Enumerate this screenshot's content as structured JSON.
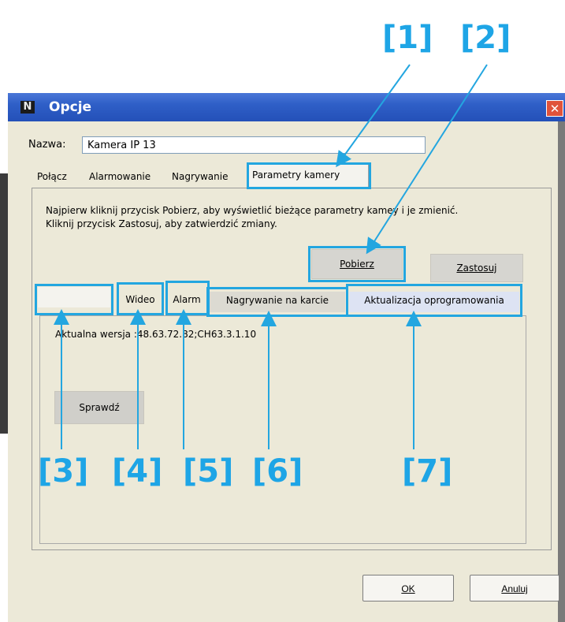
{
  "window": {
    "title": "Opcje",
    "app_icon_glyph": "N",
    "close_glyph": "✕"
  },
  "name_field": {
    "label": "Nazwa:",
    "value": "Kamera IP 13"
  },
  "tabs": [
    {
      "label": "Połącz",
      "active": false
    },
    {
      "label": "Alarmowanie",
      "active": false
    },
    {
      "label": "Nagrywanie",
      "active": false
    },
    {
      "label": "Parametry kamery",
      "active": true
    }
  ],
  "info_text": {
    "line1": "Najpierw kliknij przycisk Pobierz, aby wyświetlić bieżące parametry kamey i  je zmienić.",
    "line2": "Kliknij przycisk Zastosuj, aby zatwierdzić zmiany."
  },
  "buttons": {
    "fetch": "Pobierz",
    "apply": "Zastosuj",
    "check": "Sprawdź",
    "ok": "OK",
    "cancel": "Anuluj"
  },
  "subtabs": [
    {
      "label": "",
      "active": false
    },
    {
      "label": "Wideo",
      "active": false
    },
    {
      "label": "Alarm",
      "active": false
    },
    {
      "label": "Nagrywanie na karcie",
      "active": false
    },
    {
      "label": "Aktualizacja oprogramowania",
      "active": true
    }
  ],
  "version": {
    "text": "Aktualna wersja :48.63.72.82;CH63.3.1.10"
  },
  "markers": [
    "[1]",
    "[2]",
    "[3]",
    "[4]",
    "[5]",
    "[6]",
    "[7]"
  ],
  "colors": {
    "annotation": "#23a6e0",
    "titlebar": "#2f5fc7",
    "dialog_bg": "#ece9d8"
  }
}
